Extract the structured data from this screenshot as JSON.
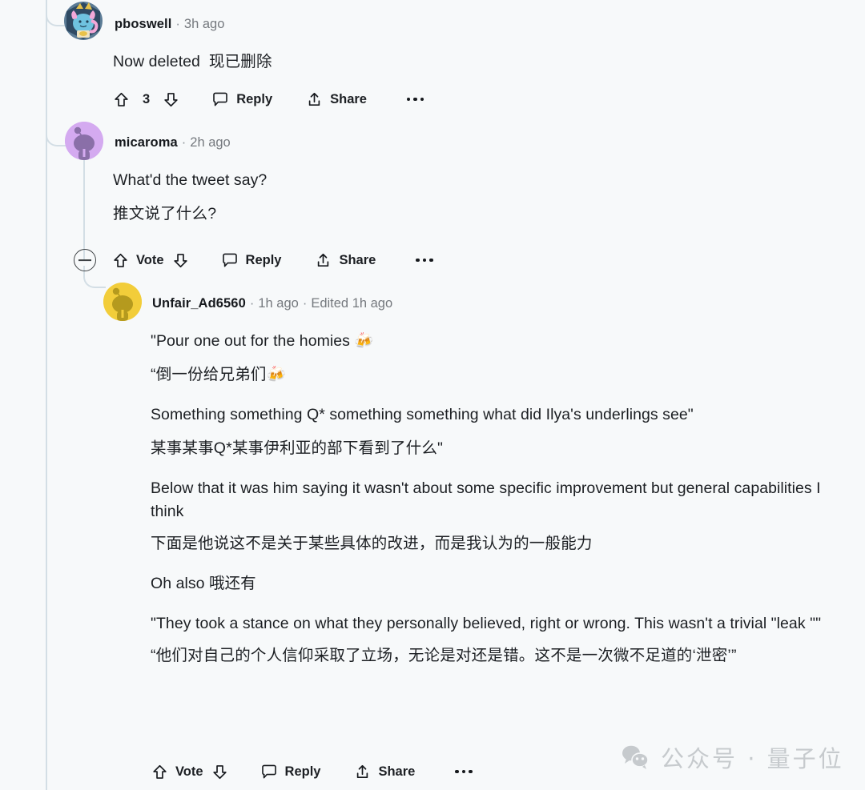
{
  "thread": {
    "comments": [
      {
        "id": "c1",
        "username": "pboswell",
        "separator": "·",
        "timestamp": "3h ago",
        "text_en": "Now deleted",
        "text_zh": "现已删除",
        "avatar_kind": "nft-avatar",
        "actions": {
          "upvote_label": "upvote-icon",
          "vote_count": "3",
          "downvote_label": "downvote-icon",
          "reply": "Reply",
          "share": "Share",
          "more": "…"
        }
      },
      {
        "id": "c2",
        "username": "micaroma",
        "separator": "·",
        "timestamp": "2h ago",
        "text_en": "What'd the tweet say?",
        "text_zh": "推文说了什么?",
        "avatar_kind": "snoo-purple",
        "actions": {
          "collapse": "collapse-thread",
          "vote": "Vote",
          "reply": "Reply",
          "share": "Share",
          "more": "…"
        }
      },
      {
        "id": "c3",
        "username": "Unfair_Ad6560",
        "separator": "·",
        "timestamp": "1h ago",
        "separator2": "·",
        "edited": "Edited 1h ago",
        "avatar_kind": "snoo-yellow",
        "paragraphs": [
          {
            "en": "\"Pour one out for the homies 🍻",
            "zh": "“倒一份给兄弟们🍻"
          },
          {
            "en": "Something something Q* something something what did Ilya's underlings see\"",
            "zh": "某事某事Q*某事伊利亚的部下看到了什么\""
          },
          {
            "en": "Below that it was him saying it wasn't about some specific improvement but general capabilities I think",
            "zh": "下面是他说这不是关于某些具体的改进，而是我认为的一般能力"
          },
          {
            "en": "Oh also   哦还有",
            "zh": ""
          },
          {
            "en": "\"They took a stance on what they personally believed, right or wrong. This wasn't a trivial \"leak \"\"",
            "zh": "“他们对自己的个人信仰采取了立场，无论是对还是错。这不是一次微不足道的‘泄密’”"
          }
        ],
        "actions": {
          "vote": "Vote",
          "reply": "Reply",
          "share": "Share",
          "more": "…"
        }
      }
    ]
  },
  "watermark": {
    "icon": "wechat-icon",
    "text": "公众号 · 量子位"
  },
  "colors": {
    "background": "#f7f9fa",
    "thread_line": "#d3dee5",
    "text_primary": "#1c1f23",
    "text_muted": "#75797e",
    "avatar_purple": "#d4aaf0",
    "avatar_yellow": "#f2cd3a",
    "watermark": "#c6cacd"
  }
}
